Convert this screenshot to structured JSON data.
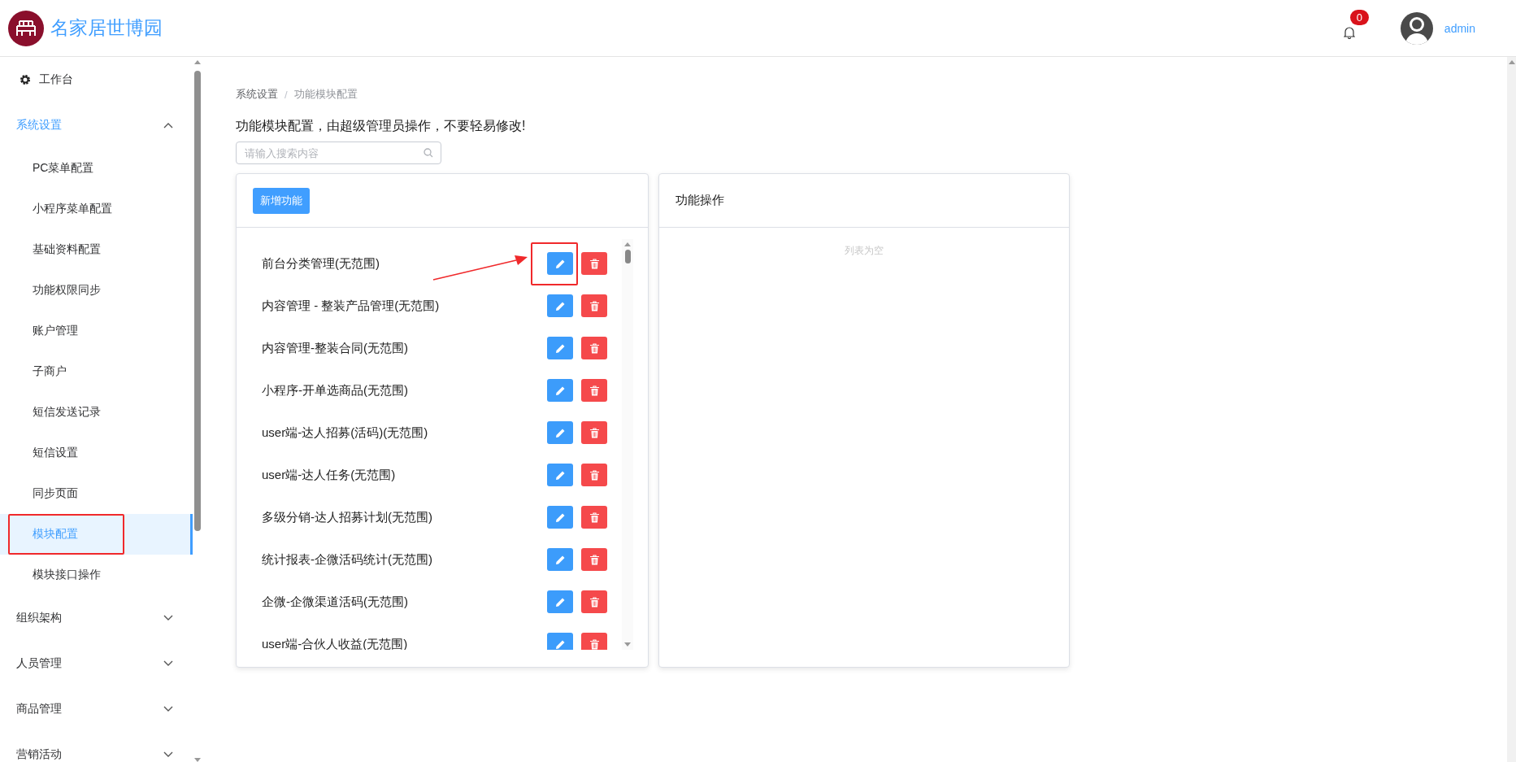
{
  "header": {
    "logo_text": "名家居世博园",
    "notification_count": "0",
    "user_name": "admin"
  },
  "sidebar": {
    "items": [
      {
        "kind": "link",
        "label": "工作台"
      },
      {
        "kind": "group",
        "label": "系统设置",
        "expanded": true,
        "children": [
          {
            "label": "PC菜单配置",
            "selected": false,
            "highlighted": false
          },
          {
            "label": "小程序菜单配置",
            "selected": false,
            "highlighted": false
          },
          {
            "label": "基础资料配置",
            "selected": false,
            "highlighted": false
          },
          {
            "label": "功能权限同步",
            "selected": false,
            "highlighted": false
          },
          {
            "label": "账户管理",
            "selected": false,
            "highlighted": false
          },
          {
            "label": "子商户",
            "selected": false,
            "highlighted": false
          },
          {
            "label": "短信发送记录",
            "selected": false,
            "highlighted": false
          },
          {
            "label": "短信设置",
            "selected": false,
            "highlighted": false
          },
          {
            "label": "同步页面",
            "selected": false,
            "highlighted": false
          },
          {
            "label": "模块配置",
            "selected": true,
            "highlighted": true
          },
          {
            "label": "模块接口操作",
            "selected": false,
            "highlighted": false
          }
        ]
      },
      {
        "kind": "group",
        "label": "组织架构",
        "expanded": false
      },
      {
        "kind": "group",
        "label": "人员管理",
        "expanded": false
      },
      {
        "kind": "group",
        "label": "商品管理",
        "expanded": false
      },
      {
        "kind": "group",
        "label": "营销活动",
        "expanded": false
      }
    ]
  },
  "breadcrumb": {
    "separator": "/",
    "items": [
      "系统设置",
      "功能模块配置"
    ]
  },
  "notice": "功能模块配置，由超级管理员操作，不要轻易修改!",
  "search": {
    "placeholder": "请输入搜索内容"
  },
  "function_panel": {
    "add_button": "新增功能",
    "items": [
      {
        "name": "前台分类管理(无范围)",
        "highlighted": true
      },
      {
        "name": "内容管理 - 整装产品管理(无范围)",
        "highlighted": false
      },
      {
        "name": "内容管理-整装合同(无范围)",
        "highlighted": false
      },
      {
        "name": "小程序-开单选商品(无范围)",
        "highlighted": false
      },
      {
        "name": "user端-达人招募(活码)(无范围)",
        "highlighted": false
      },
      {
        "name": "user端-达人任务(无范围)",
        "highlighted": false
      },
      {
        "name": "多级分销-达人招募计划(无范围)",
        "highlighted": false
      },
      {
        "name": "统计报表-企微活码统计(无范围)",
        "highlighted": false
      },
      {
        "name": "企微-企微渠道活码(无范围)",
        "highlighted": false
      },
      {
        "name": "user端-合伙人收益(无范围)",
        "highlighted": false
      }
    ]
  },
  "operation_panel": {
    "title": "功能操作",
    "empty_text": "列表为空"
  }
}
